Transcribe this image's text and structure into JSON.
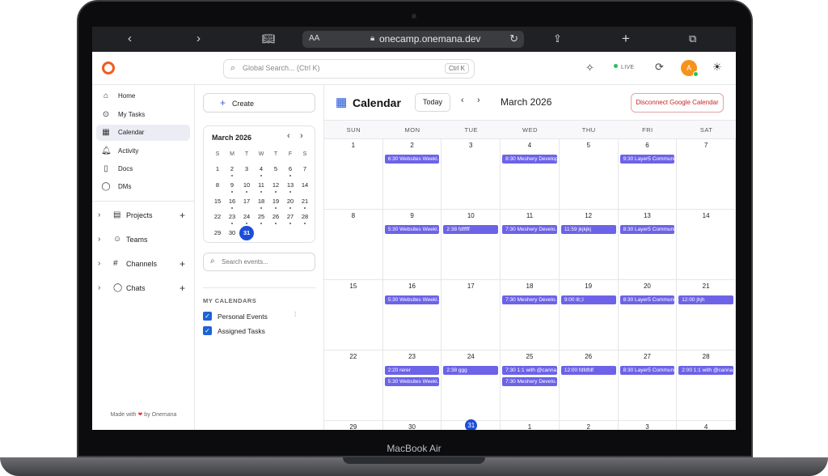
{
  "device": {
    "label": "MacBook Air"
  },
  "browser": {
    "aa": "AA",
    "url": "onecamp.onemana.dev"
  },
  "header": {
    "search_placeholder": "Global Search... (Ctrl K)",
    "search_shortcut": "Ctrl K",
    "live_label": "LIVE",
    "avatar_initial": "A"
  },
  "sidebar": {
    "items": [
      {
        "label": "Home",
        "icon": "home-icon",
        "glyph": "⌂"
      },
      {
        "label": "My Tasks",
        "icon": "check-circle-icon",
        "glyph": "⊙"
      },
      {
        "label": "Calendar",
        "icon": "calendar-icon",
        "glyph": "▦"
      },
      {
        "label": "Activity",
        "icon": "bell-icon",
        "glyph": "🔔︎"
      },
      {
        "label": "Docs",
        "icon": "document-icon",
        "glyph": "▯"
      },
      {
        "label": "DMs",
        "icon": "chat-icon",
        "glyph": "◯"
      }
    ],
    "groups": [
      {
        "label": "Projects",
        "icon": "clipboard-icon",
        "glyph": "▤"
      },
      {
        "label": "Teams",
        "icon": "users-icon",
        "glyph": "☺"
      },
      {
        "label": "Channels",
        "icon": "hash-icon",
        "glyph": "#"
      },
      {
        "label": "Chats",
        "icon": "chat-bubble-icon",
        "glyph": "◯"
      }
    ],
    "footer_prefix": "Made with",
    "footer_suffix": "by Onemana"
  },
  "midpanel": {
    "create_label": "Create",
    "mini_cal": {
      "title": "March 2026",
      "dow": [
        "S",
        "M",
        "T",
        "W",
        "T",
        "F",
        "S"
      ],
      "weeks": [
        [
          1,
          2,
          3,
          4,
          5,
          6,
          7
        ],
        [
          8,
          9,
          10,
          11,
          12,
          13,
          14
        ],
        [
          15,
          16,
          17,
          18,
          19,
          20,
          21
        ],
        [
          22,
          23,
          24,
          25,
          26,
          27,
          28
        ],
        [
          29,
          30,
          31
        ]
      ],
      "event_days": [
        2,
        4,
        6,
        9,
        10,
        11,
        12,
        13,
        16,
        18,
        19,
        20,
        21,
        23,
        24,
        25,
        26,
        27,
        28
      ],
      "today": 31
    },
    "search_placeholder": "Search events...",
    "my_calendars_heading": "MY CALENDARS",
    "calendars": [
      "Personal Events",
      "Assigned Tasks"
    ]
  },
  "calendar": {
    "title": "Calendar",
    "today_label": "Today",
    "month_label": "March 2026",
    "disconnect_label": "Disconnect Google Calendar",
    "dow": [
      "SUN",
      "MON",
      "TUE",
      "WED",
      "THU",
      "FRI",
      "SAT"
    ],
    "weeks": [
      {
        "days": [
          "1",
          "2",
          "3",
          "4",
          "5",
          "6",
          "7"
        ],
        "events": [
          [],
          [
            "6:30 Websites Weekl..."
          ],
          [],
          [
            "8:30 Meshery Develop..."
          ],
          [],
          [
            "9:30 Layer5 Communi..."
          ],
          []
        ]
      },
      {
        "days": [
          "8",
          "9",
          "10",
          "11",
          "12",
          "13",
          "14"
        ],
        "events": [
          [],
          [
            "5:30 Websites Weekl..."
          ],
          [
            "2:38 fdfffff"
          ],
          [
            "7:30 Meshery Develo..."
          ],
          [
            "11:59 jkjkjkj"
          ],
          [
            "8:30 Layer5 Communi..."
          ],
          []
        ]
      },
      {
        "days": [
          "15",
          "16",
          "17",
          "18",
          "19",
          "20",
          "21"
        ],
        "events": [
          [],
          [
            "5:30 Websites Weekl..."
          ],
          [],
          [
            "7:30 Meshery Develo..."
          ],
          [
            "9:00 lll;;l"
          ],
          [
            "8:30 Layer5 Communi..."
          ],
          [
            "12:00 jhjh"
          ]
        ]
      },
      {
        "days": [
          "22",
          "23",
          "24",
          "25",
          "26",
          "27",
          "28"
        ],
        "events": [
          [],
          [
            "2:20 rerer",
            "5:30 Websites Weekl..."
          ],
          [
            "2:38 ggg"
          ],
          [
            "7:30 1:1 with @canna...",
            "7:30 Meshery Develo..."
          ],
          [
            "12:00 fdfdfdf"
          ],
          [
            "8:30 Layer5 Communi..."
          ],
          [
            "2:00 1:1 with @canna..."
          ]
        ]
      },
      {
        "days": [
          "29",
          "30",
          "31",
          "1",
          "2",
          "3",
          "4"
        ],
        "events": [
          [],
          [],
          [],
          [],
          [],
          [],
          []
        ],
        "today_index": 2
      }
    ],
    "event_color": "#6c63e8"
  },
  "colors": {
    "accent": "#1d4ed8",
    "logo": "#f25b1f",
    "danger": "#c62828"
  }
}
